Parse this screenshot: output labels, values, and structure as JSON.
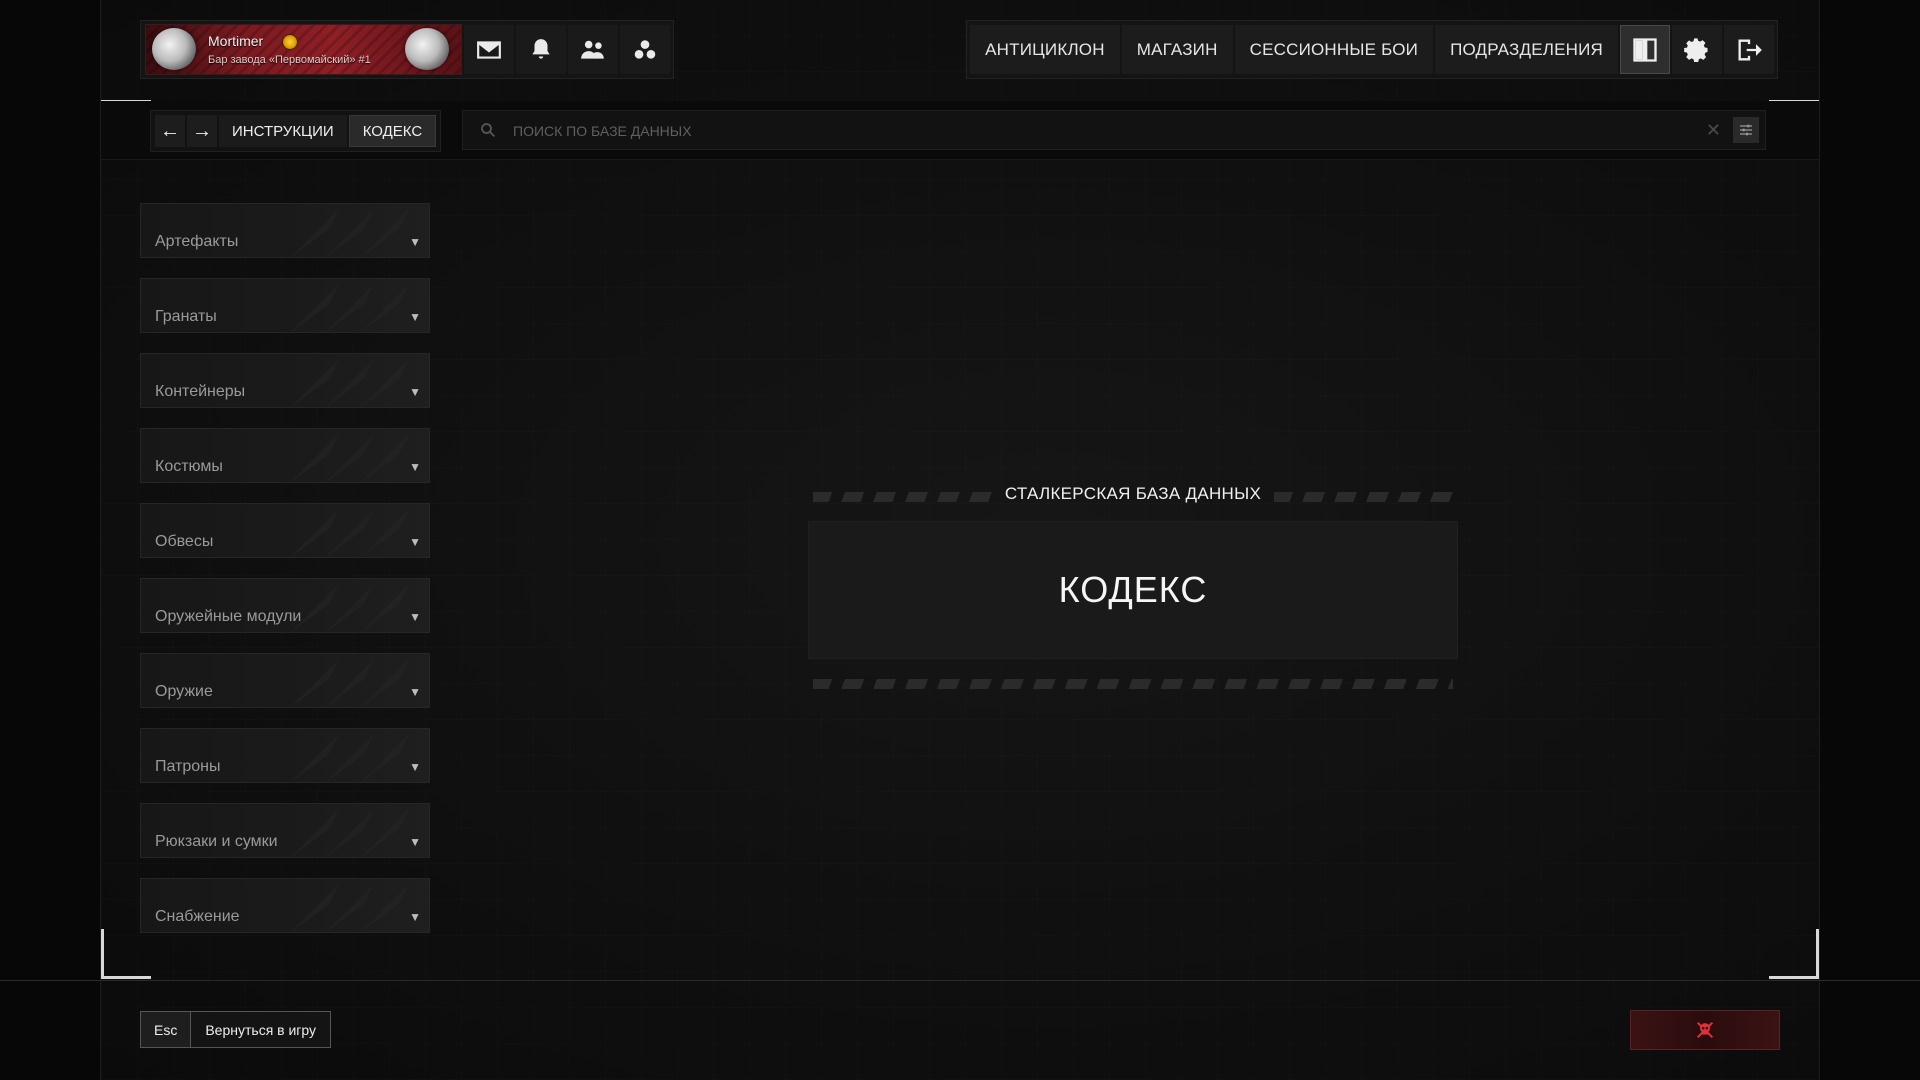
{
  "profile": {
    "name": "Mortimer",
    "subtitle": "Бар завода «Первомайский» #1",
    "icons": [
      "mail-icon",
      "bell-icon",
      "friends-icon",
      "group-icon"
    ]
  },
  "nav": {
    "items": [
      "АНТИЦИКЛОН",
      "МАГАЗИН",
      "СЕССИОННЫЕ БОИ",
      "ПОДРАЗДЕЛЕНИЯ"
    ],
    "icons": [
      "book-icon",
      "gear-icon",
      "exit-icon"
    ],
    "active_icon": "book-icon"
  },
  "breadcrumbs": {
    "back": "←",
    "forward": "→",
    "items": [
      "ИНСТРУКЦИИ",
      "КОДЕКС"
    ],
    "active": "КОДЕКС"
  },
  "search": {
    "placeholder": "ПОИСК ПО БАЗЕ ДАННЫХ",
    "clear": "✕"
  },
  "categories": [
    "Артефакты",
    "Гранаты",
    "Контейнеры",
    "Костюмы",
    "Обвесы",
    "Оружейные модули",
    "Оружие",
    "Патроны",
    "Рюкзаки и сумки",
    "Снабжение"
  ],
  "center": {
    "subtitle": "СТАЛКЕРСКАЯ БАЗА ДАННЫХ",
    "title": "КОДЕКС"
  },
  "footer": {
    "key": "Esc",
    "action": "Вернуться в игру"
  },
  "colors": {
    "accent": "#8e1f25",
    "danger": "#e0303a",
    "text": "#e6e6e6"
  }
}
